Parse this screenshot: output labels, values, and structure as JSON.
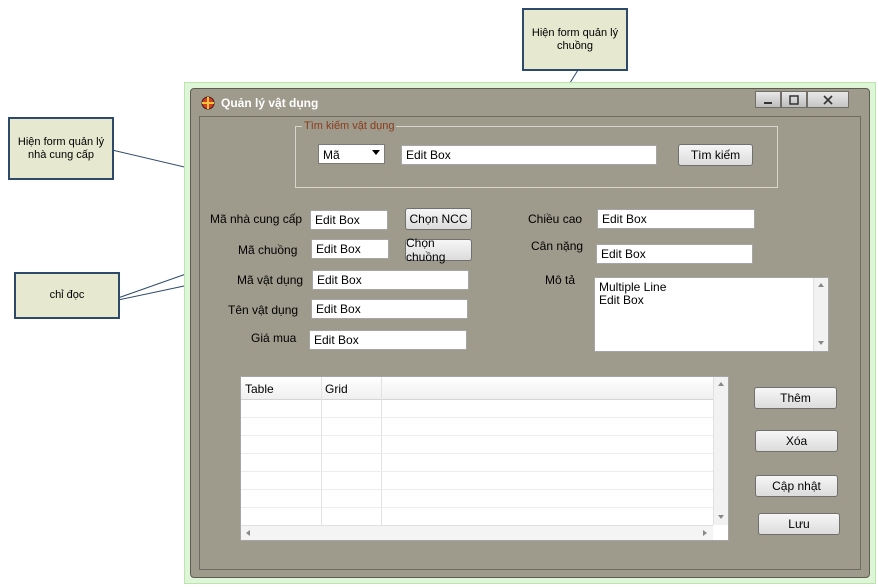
{
  "window": {
    "title": "Quản lý vật dụng",
    "accent_color": "#9e9a8c"
  },
  "callouts": {
    "show_cage_form": "Hiện form quản lý chuồng",
    "show_supplier_form": "Hiện form quản lý nhà cung cấp",
    "read_only": "chỉ đọc"
  },
  "search": {
    "group_label": "Tìm kiếm vật dụng",
    "combo_value": "Mã",
    "input_value": "Edit Box",
    "button_label": "Tìm kiếm"
  },
  "form": {
    "supplier_code_label": "Mã nhà cung cấp",
    "supplier_code_value": "Edit Box",
    "choose_supplier_label": "Chọn NCC",
    "cage_code_label": "Mã chuồng",
    "cage_code_value": "Edit Box",
    "choose_cage_label": "Chọn chuồng",
    "item_code_label": "Mã vật dụng",
    "item_code_value": "Edit Box",
    "item_name_label": "Tên vật dụng",
    "item_name_value": "Edit Box",
    "price_label": "Giá mua",
    "price_value": "Edit Box",
    "height_label": "Chiều cao",
    "height_value": "Edit Box",
    "weight_label": "Cân nặng",
    "weight_value": "Edit Box",
    "description_label": "Mô tả",
    "description_line1": "Multiple Line",
    "description_line2": "Edit Box"
  },
  "grid": {
    "col1": "Table",
    "col2": "Grid"
  },
  "actions": {
    "add_label": "Thêm",
    "delete_label": "Xóa",
    "update_label": "Cập nhật",
    "save_label": "Lưu"
  }
}
